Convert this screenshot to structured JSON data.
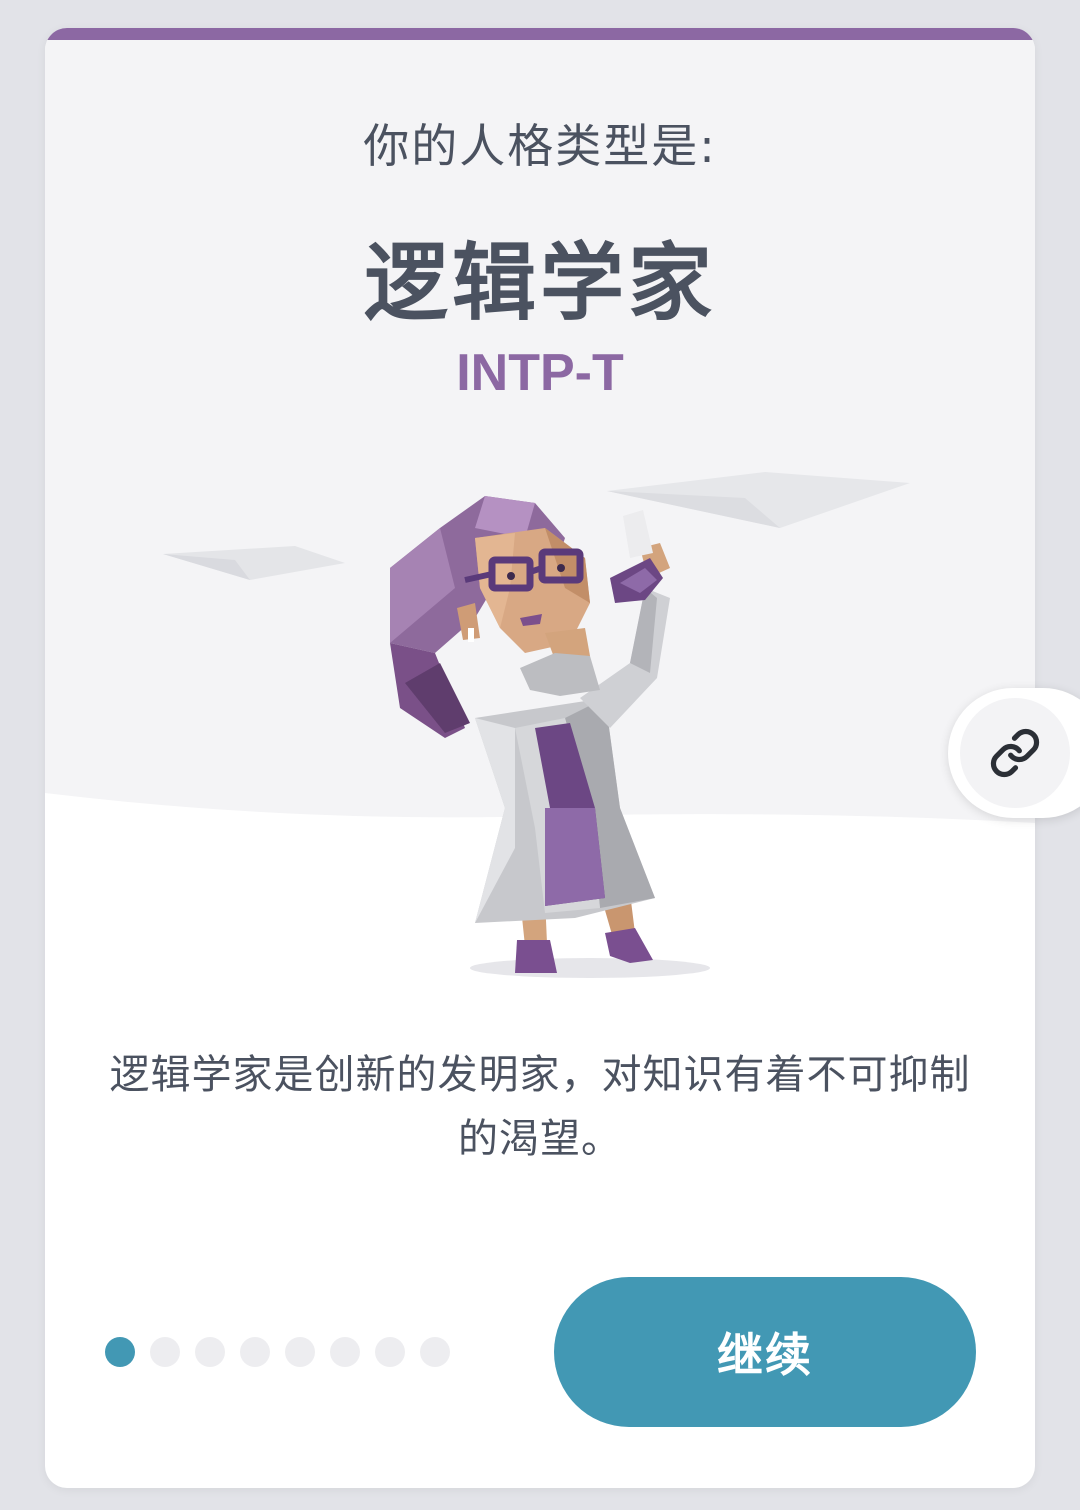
{
  "result": {
    "subtitle": "你的人格类型是:",
    "type_name": "逻辑学家",
    "type_code": "INTP-T",
    "description": "逻辑学家是创新的发明家，对知识有着不可抑制的渴望。"
  },
  "pager": {
    "total": 8,
    "current": 1
  },
  "actions": {
    "continue_label": "继续",
    "share_link_icon": "link-icon"
  },
  "colors": {
    "accent_purple": "#8c68a3",
    "accent_blue": "#4298b4",
    "text_dark": "#4b5260"
  }
}
